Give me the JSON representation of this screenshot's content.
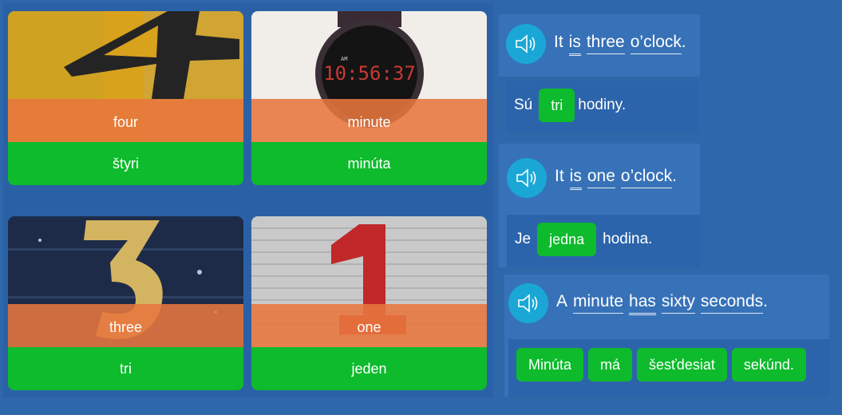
{
  "cards": [
    {
      "english": "four",
      "slovak": "štyri"
    },
    {
      "english": "minute",
      "slovak": "minúta"
    },
    {
      "english": "three",
      "slovak": "tri"
    },
    {
      "english": "one",
      "slovak": "jeden"
    }
  ],
  "watch_display": "10:56:37",
  "watch_am_label": "AM",
  "exercises": [
    {
      "english": {
        "w1": "It",
        "w2": "is",
        "w3": "three",
        "w4": "o’clock",
        "end": "."
      },
      "slovak": {
        "before": "Sú",
        "answer": "tri",
        "after": "hodiny."
      }
    },
    {
      "english": {
        "w1": "It",
        "w2": "is",
        "w3": "one",
        "w4": "o’clock",
        "end": "."
      },
      "slovak": {
        "before": "Je",
        "answer": "jedna",
        "after": "hodina."
      }
    },
    {
      "english": {
        "w1": "A",
        "w2": "minute",
        "w3": "has",
        "w4": "sixty",
        "w5": "seconds",
        "end": "."
      },
      "slovak_tiles": [
        "Minúta",
        "má",
        "šesťdesiat",
        "sekúnd."
      ]
    }
  ],
  "colors": {
    "background": "#2f67ab",
    "green": "#0dbb2c",
    "orange": "#e7763e",
    "speaker": "#1aa7d6"
  }
}
